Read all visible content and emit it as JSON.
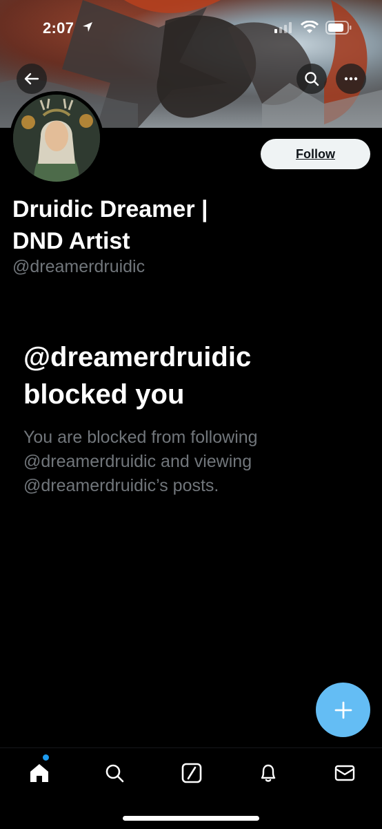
{
  "status_bar": {
    "time": "2:07"
  },
  "profile": {
    "display_name": "Druidic Dreamer | DND Artist",
    "handle": "@dreamerdruidic",
    "follow_label": "Follow"
  },
  "blocked": {
    "title": "@dreamerdruidic blocked you",
    "description": "You are blocked from following @dreamerdruidic and viewing @dreamerdruidic’s posts."
  },
  "icons": {
    "back": "arrow-left-icon",
    "search": "search-icon",
    "more": "more-horizontal-icon",
    "compose": "plus-icon",
    "nav": [
      "home-icon",
      "search-icon",
      "grok-icon",
      "bell-icon",
      "mail-icon"
    ]
  },
  "colors": {
    "accent": "#1d9bf0",
    "fab": "#64bdf4",
    "secondary_text": "#71767b"
  }
}
